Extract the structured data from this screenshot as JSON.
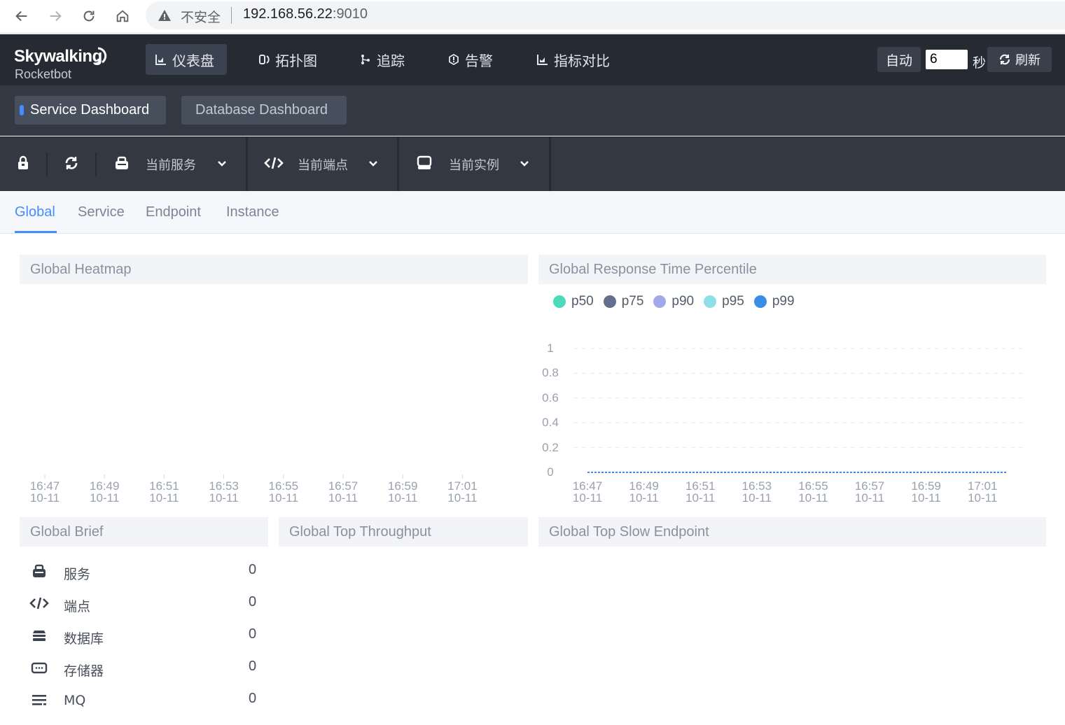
{
  "browser": {
    "security_label": "不安全",
    "url_host": "192.168.56.22",
    "url_port": ":9010"
  },
  "header": {
    "logo_main": "Skywalking",
    "logo_sub": "Rocketbot",
    "nav": [
      {
        "label": "仪表盘",
        "icon": "dashboard-icon",
        "active": true
      },
      {
        "label": "拓扑图",
        "icon": "topology-icon",
        "active": false
      },
      {
        "label": "追踪",
        "icon": "trace-icon",
        "active": false
      },
      {
        "label": "告警",
        "icon": "alarm-icon",
        "active": false
      },
      {
        "label": "指标对比",
        "icon": "compare-icon",
        "active": false
      }
    ],
    "auto_label": "自动",
    "interval_value": "6",
    "interval_unit": "秒",
    "refresh_label": "刷新"
  },
  "dashboards": {
    "tabs": [
      {
        "label": "Service Dashboard",
        "active": true
      },
      {
        "label": "Database Dashboard",
        "active": false
      }
    ]
  },
  "selectors": {
    "service": "当前服务",
    "endpoint": "当前端点",
    "instance": "当前实例"
  },
  "sub_tabs": [
    {
      "label": "Global",
      "active": true
    },
    {
      "label": "Service",
      "active": false
    },
    {
      "label": "Endpoint",
      "active": false
    },
    {
      "label": "Instance",
      "active": false
    }
  ],
  "panels": {
    "heatmap_title": "Global Heatmap",
    "percentile_title": "Global Response Time Percentile",
    "brief_title": "Global Brief",
    "throughput_title": "Global Top Throughput",
    "slow_title": "Global Top Slow Endpoint"
  },
  "brief": [
    {
      "label": "服务",
      "value": "0",
      "icon": "service-icon"
    },
    {
      "label": "端点",
      "value": "0",
      "icon": "endpoint-icon"
    },
    {
      "label": "数据库",
      "value": "0",
      "icon": "database-icon"
    },
    {
      "label": "存储器",
      "value": "0",
      "icon": "storage-icon"
    },
    {
      "label": "MQ",
      "value": "0",
      "icon": "mq-icon"
    }
  ],
  "chart_data": [
    {
      "type": "heatmap",
      "x_ticks": [
        [
          "16:47",
          "10-11"
        ],
        [
          "16:49",
          "10-11"
        ],
        [
          "16:51",
          "10-11"
        ],
        [
          "16:53",
          "10-11"
        ],
        [
          "16:55",
          "10-11"
        ],
        [
          "16:57",
          "10-11"
        ],
        [
          "16:59",
          "10-11"
        ],
        [
          "17:01",
          "10-11"
        ]
      ],
      "values": []
    },
    {
      "type": "line",
      "legend_position": "top-left",
      "grid": true,
      "ylim": [
        0,
        1
      ],
      "y_ticks": [
        "1",
        "0.8",
        "0.6",
        "0.4",
        "0.2",
        "0"
      ],
      "x_ticks": [
        [
          "16:47",
          "10-11"
        ],
        [
          "16:49",
          "10-11"
        ],
        [
          "16:51",
          "10-11"
        ],
        [
          "16:53",
          "10-11"
        ],
        [
          "16:55",
          "10-11"
        ],
        [
          "16:57",
          "10-11"
        ],
        [
          "16:59",
          "10-11"
        ],
        [
          "17:01",
          "10-11"
        ]
      ],
      "series": [
        {
          "name": "p50",
          "color": "#4ddbb7",
          "values": [
            0,
            0,
            0,
            0,
            0,
            0,
            0,
            0
          ]
        },
        {
          "name": "p75",
          "color": "#646e8e",
          "values": [
            0,
            0,
            0,
            0,
            0,
            0,
            0,
            0
          ]
        },
        {
          "name": "p90",
          "color": "#a2a8e8",
          "values": [
            0,
            0,
            0,
            0,
            0,
            0,
            0,
            0
          ]
        },
        {
          "name": "p95",
          "color": "#8fe0e6",
          "values": [
            0,
            0,
            0,
            0,
            0,
            0,
            0,
            0
          ]
        },
        {
          "name": "p99",
          "color": "#3a8ee6",
          "values": [
            0,
            0,
            0,
            0,
            0,
            0,
            0,
            0
          ]
        }
      ]
    }
  ]
}
